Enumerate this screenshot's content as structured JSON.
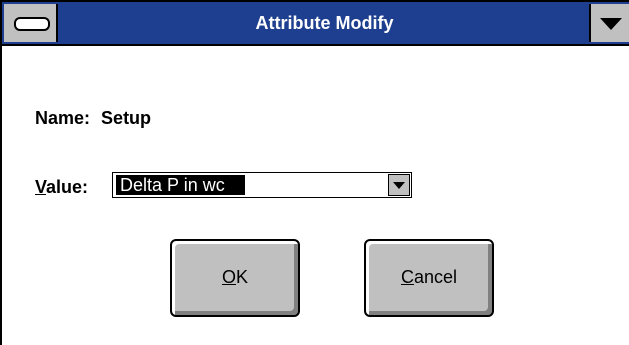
{
  "window": {
    "title": "Attribute Modify"
  },
  "icons": {
    "system_menu": "system-menu-icon",
    "maximize": "down-triangle-icon",
    "combo_arrow": "chevron-down-icon"
  },
  "form": {
    "name_label": "Name:",
    "name_value": "Setup",
    "value_label_mnemonic": "V",
    "value_label_rest": "alue:",
    "value_selected": "Delta P in wc"
  },
  "buttons": {
    "ok_mnemonic": "O",
    "ok_rest": "K",
    "cancel_mnemonic": "C",
    "cancel_rest": "ancel"
  },
  "colors": {
    "titlebar": "#1e3f8f",
    "button_face": "#c0c0c0",
    "selection": "#000000"
  }
}
